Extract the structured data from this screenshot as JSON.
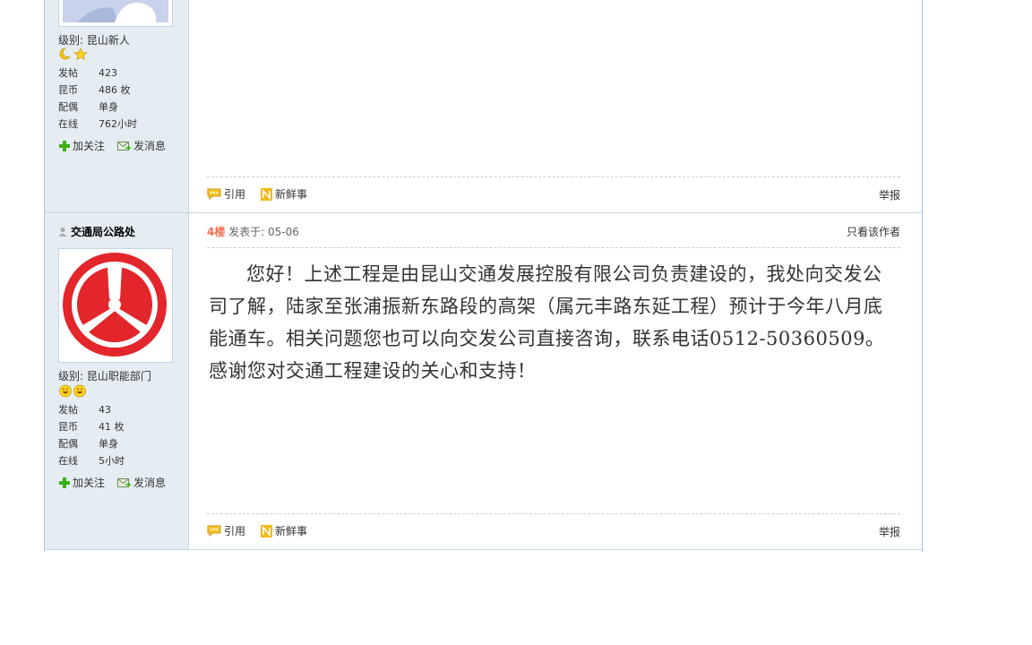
{
  "post1": {
    "level_label": "级别: 昆山新人",
    "stats": [
      {
        "key": "发帖",
        "value": "423"
      },
      {
        "key": "昆币",
        "value": "486 枚"
      },
      {
        "key": "配偶",
        "value": "单身"
      },
      {
        "key": "在线",
        "value": "762小时"
      }
    ],
    "follow_label": "加关注",
    "message_label": "发消息",
    "quote_label": "引用",
    "fresh_label": "新鲜事",
    "report_label": "举报"
  },
  "post2": {
    "username": "交通局公路处",
    "level_label": "级别: 昆山职能部门",
    "stats": [
      {
        "key": "发帖",
        "value": "43"
      },
      {
        "key": "昆币",
        "value": "41 枚"
      },
      {
        "key": "配偶",
        "value": "单身"
      },
      {
        "key": "在线",
        "value": "5小时"
      }
    ],
    "follow_label": "加关注",
    "message_label": "发消息",
    "floor": "4楼",
    "posted_at": " 发表于: 05-06",
    "only_author": "只看该作者",
    "content": "您好！上述工程是由昆山交通发展控股有限公司负责建设的，我处向交发公司了解，陆家至张浦振新东路段的高架（属元丰路东延工程）预计于今年八月底能通车。相关问题您也可以向交发公司直接咨询，联系电话0512-50360509。感谢您对交通工程建设的关心和支持！",
    "quote_label": "引用",
    "fresh_label": "新鲜事",
    "report_label": "举报"
  },
  "colors": {
    "sidebar_bg": "#e5edf2",
    "border": "#a8c8e8",
    "floor": "#f26c4f",
    "logo_red": "#e3262b"
  }
}
